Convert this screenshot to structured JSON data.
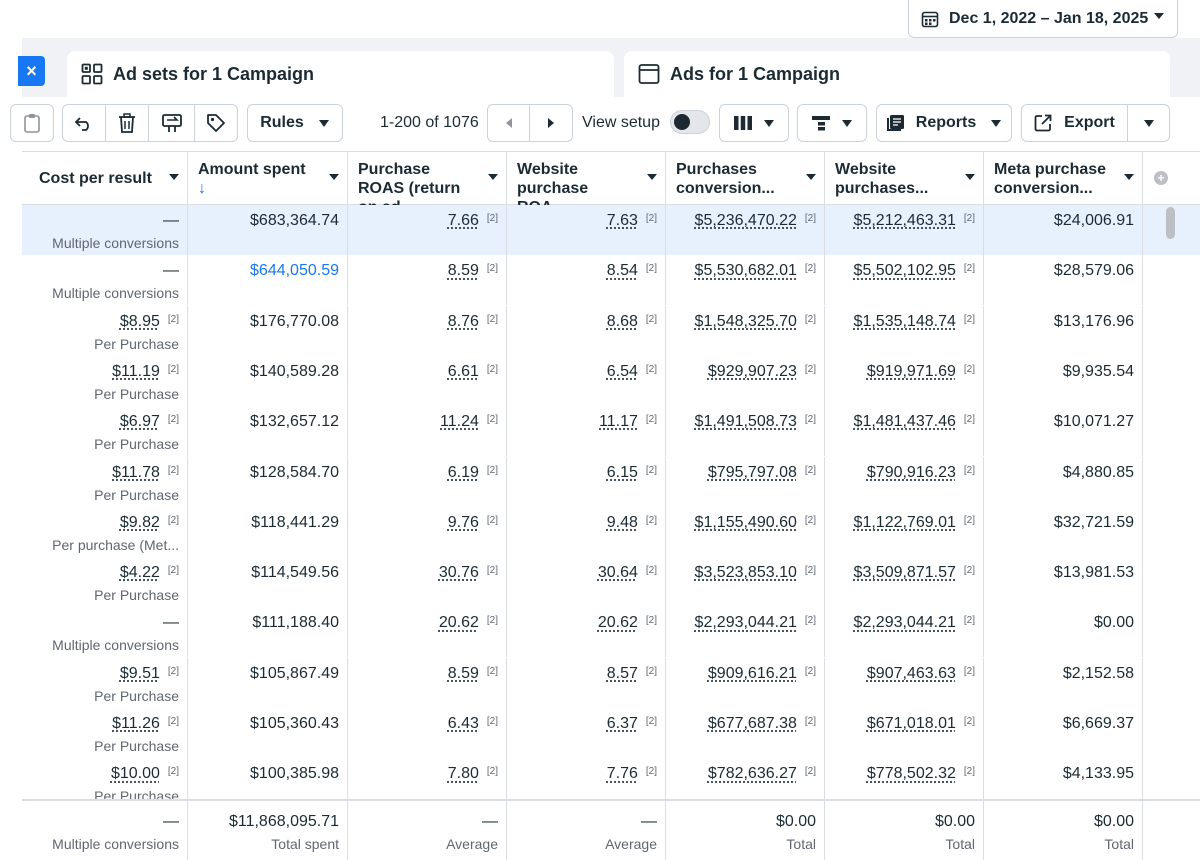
{
  "date_range": {
    "label": "Dec 1, 2022 – Jan 18, 2025"
  },
  "tabs": {
    "close_glyph": "×",
    "adsets_label": "Ad sets for 1 Campaign",
    "ads_label": "Ads for 1 Campaign"
  },
  "toolbar": {
    "rules_label": "Rules",
    "pager_text": "1-200 of 1076",
    "view_setup_label": "View setup",
    "view_setup_on": false,
    "reports_label": "Reports",
    "export_label": "Export"
  },
  "table": {
    "columns": [
      {
        "label": "Cost per result",
        "sort": ""
      },
      {
        "label": "Amount spent",
        "sort": "↓"
      },
      {
        "label": "Purchase ROAS (return on ad...",
        "sort": ""
      },
      {
        "label": "Website purchase ROA...",
        "sort": ""
      },
      {
        "label": "Purchases conversion...",
        "sort": ""
      },
      {
        "label": "Website purchases...",
        "sort": ""
      },
      {
        "label": "Meta purchase conversion...",
        "sort": ""
      }
    ],
    "footnote": "[2]",
    "rows": [
      {
        "cost": "—",
        "cost_sub": "Multiple conversions",
        "spent": "$683,364.74",
        "roas": "7.66",
        "web_roas": "7.63",
        "conv_value": "$5,236,470.22",
        "web_value": "$5,212,463.31",
        "meta_value": "$24,006.91",
        "selected": true
      },
      {
        "cost": "—",
        "cost_sub": "Multiple conversions",
        "spent": "$644,050.59",
        "roas": "8.59",
        "web_roas": "8.54",
        "conv_value": "$5,530,682.01",
        "web_value": "$5,502,102.95",
        "meta_value": "$28,579.06",
        "spent_blue": true
      },
      {
        "cost": "$8.95",
        "cost_sub": "Per Purchase",
        "spent": "$176,770.08",
        "roas": "8.76",
        "web_roas": "8.68",
        "conv_value": "$1,548,325.70",
        "web_value": "$1,535,148.74",
        "meta_value": "$13,176.96"
      },
      {
        "cost": "$11.19",
        "cost_sub": "Per Purchase",
        "spent": "$140,589.28",
        "roas": "6.61",
        "web_roas": "6.54",
        "conv_value": "$929,907.23",
        "web_value": "$919,971.69",
        "meta_value": "$9,935.54"
      },
      {
        "cost": "$6.97",
        "cost_sub": "Per Purchase",
        "spent": "$132,657.12",
        "roas": "11.24",
        "web_roas": "11.17",
        "conv_value": "$1,491,508.73",
        "web_value": "$1,481,437.46",
        "meta_value": "$10,071.27"
      },
      {
        "cost": "$11.78",
        "cost_sub": "Per Purchase",
        "spent": "$128,584.70",
        "roas": "6.19",
        "web_roas": "6.15",
        "conv_value": "$795,797.08",
        "web_value": "$790,916.23",
        "meta_value": "$4,880.85"
      },
      {
        "cost": "$9.82",
        "cost_sub": "Per purchase (Met...",
        "spent": "$118,441.29",
        "roas": "9.76",
        "web_roas": "9.48",
        "conv_value": "$1,155,490.60",
        "web_value": "$1,122,769.01",
        "meta_value": "$32,721.59"
      },
      {
        "cost": "$4.22",
        "cost_sub": "Per Purchase",
        "spent": "$114,549.56",
        "roas": "30.76",
        "web_roas": "30.64",
        "conv_value": "$3,523,853.10",
        "web_value": "$3,509,871.57",
        "meta_value": "$13,981.53"
      },
      {
        "cost": "—",
        "cost_sub": "Multiple conversions",
        "spent": "$111,188.40",
        "roas": "20.62",
        "web_roas": "20.62",
        "conv_value": "$2,293,044.21",
        "web_value": "$2,293,044.21",
        "meta_value": "$0.00"
      },
      {
        "cost": "$9.51",
        "cost_sub": "Per Purchase",
        "spent": "$105,867.49",
        "roas": "8.59",
        "web_roas": "8.57",
        "conv_value": "$909,616.21",
        "web_value": "$907,463.63",
        "meta_value": "$2,152.58"
      },
      {
        "cost": "$11.26",
        "cost_sub": "Per Purchase",
        "spent": "$105,360.43",
        "roas": "6.43",
        "web_roas": "6.37",
        "conv_value": "$677,687.38",
        "web_value": "$671,018.01",
        "meta_value": "$6,669.37"
      },
      {
        "cost": "$10.00",
        "cost_sub": "Per Purchase",
        "spent": "$100,385.98",
        "roas": "7.80",
        "web_roas": "7.76",
        "conv_value": "$782,636.27",
        "web_value": "$778,502.32",
        "meta_value": "$4,133.95"
      }
    ],
    "totals": {
      "cost": "—",
      "cost_sub": "Multiple conversions",
      "spent": "$11,868,095.71",
      "spent_sub": "Total spent",
      "roas": "—",
      "roas_sub": "Average",
      "web_roas": "—",
      "web_roas_sub": "Average",
      "conv_value": "$0.00",
      "conv_value_sub": "Total",
      "web_value": "$0.00",
      "web_value_sub": "Total",
      "meta_value": "$0.00",
      "meta_value_sub": "Total"
    }
  },
  "colors": {
    "accent": "#1877f2",
    "text": "#1c2b33",
    "muted": "#606770",
    "border": "#dadde1",
    "selected_row": "#e7f0fd"
  },
  "icons": {
    "calendar": "calendar-icon",
    "close": "close-icon",
    "adsets": "adsets-grid-icon",
    "ads": "ad-card-icon",
    "plus": "add-column-icon"
  }
}
